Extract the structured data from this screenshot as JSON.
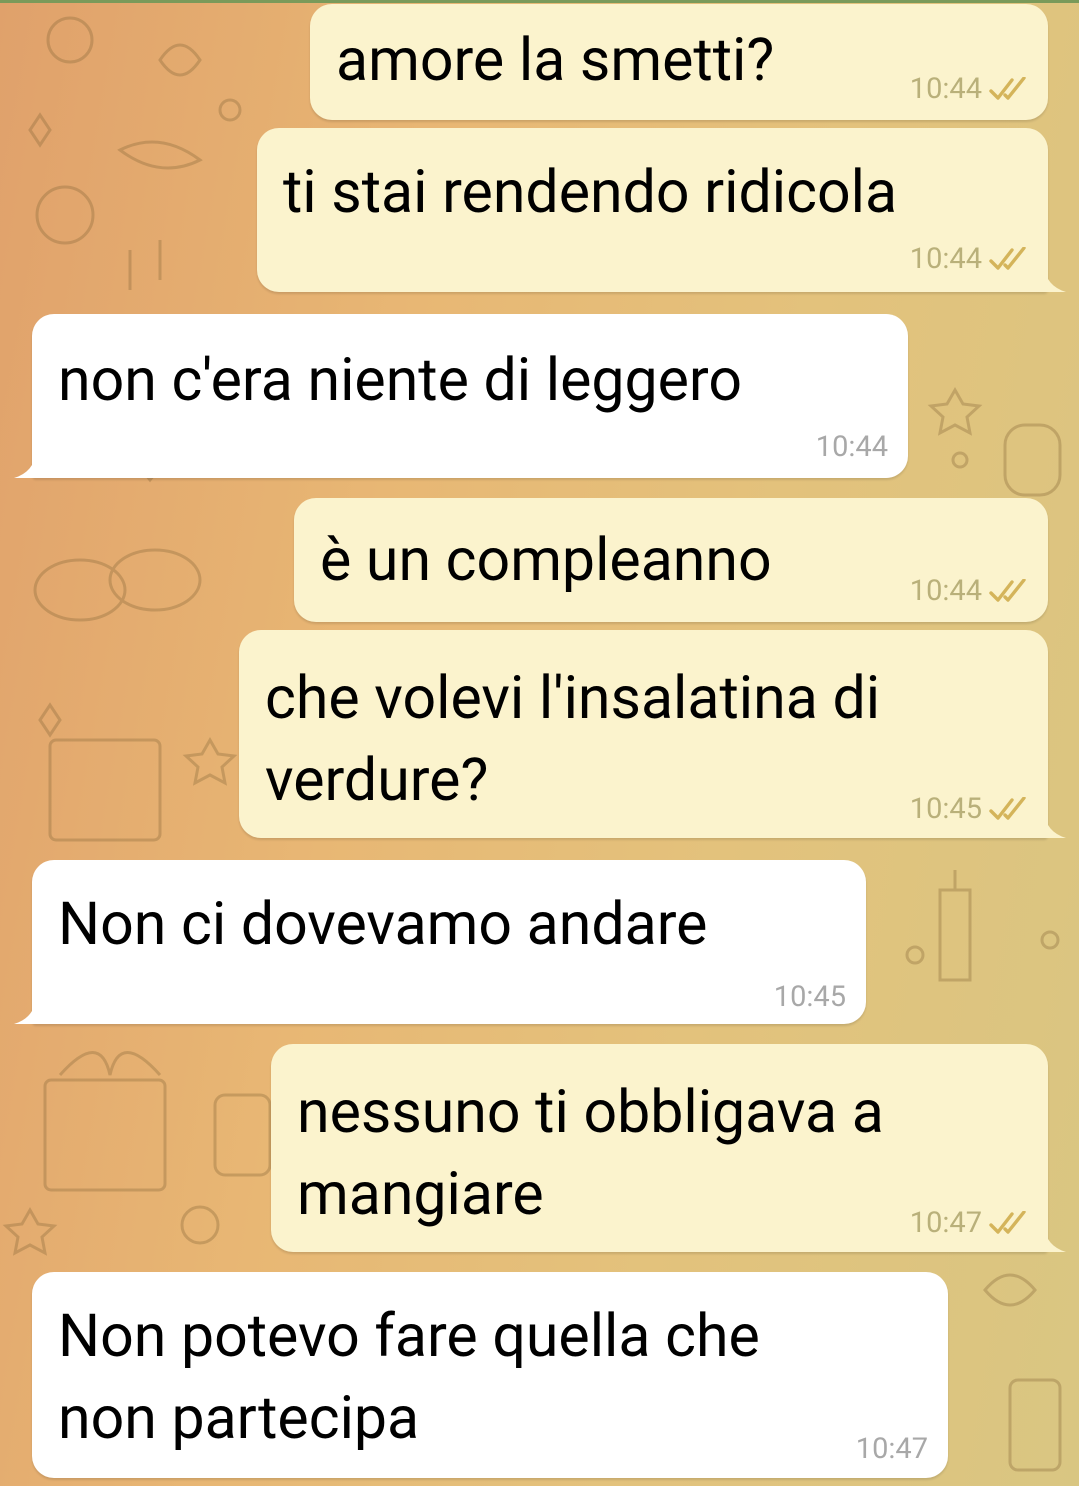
{
  "colors": {
    "outgoing_bubble": "#fbf3cd",
    "incoming_bubble": "#ffffff",
    "outgoing_meta": "#b9b07a",
    "incoming_meta": "#a8a8a8",
    "read_ticks": "#d4b45a"
  },
  "messages": [
    {
      "direction": "outgoing",
      "lines": [
        "amore la smetti?"
      ],
      "time": "10:44",
      "status_icon": "double-check-icon"
    },
    {
      "direction": "outgoing",
      "lines": [
        "ti stai rendendo ridicola"
      ],
      "time": "10:44",
      "status_icon": "double-check-icon"
    },
    {
      "direction": "incoming",
      "lines": [
        "non c'era niente di leggero"
      ],
      "time": "10:44"
    },
    {
      "direction": "outgoing",
      "lines": [
        "è un compleanno"
      ],
      "time": "10:44",
      "status_icon": "double-check-icon"
    },
    {
      "direction": "outgoing",
      "lines": [
        "che volevi l'insalatina di",
        "verdure?"
      ],
      "time": "10:45",
      "status_icon": "double-check-icon"
    },
    {
      "direction": "incoming",
      "lines": [
        "Non ci dovevamo andare"
      ],
      "time": "10:45"
    },
    {
      "direction": "outgoing",
      "lines": [
        "nessuno ti obbligava a",
        "mangiare"
      ],
      "time": "10:47",
      "status_icon": "double-check-icon"
    },
    {
      "direction": "incoming",
      "lines": [
        "Non potevo fare quella che",
        "non partecipa"
      ],
      "time": "10:47"
    }
  ]
}
